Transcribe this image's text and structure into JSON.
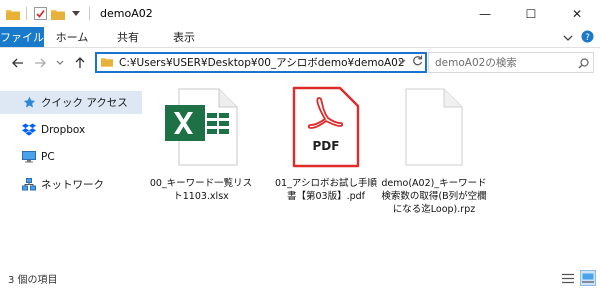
{
  "window": {
    "title": "demoA02",
    "minimize": "—",
    "maximize": "☐",
    "close": "✕"
  },
  "ribbon": {
    "tabs": [
      "ファイル",
      "ホーム",
      "共有",
      "表示"
    ]
  },
  "address": {
    "path": "C:¥Users¥USER¥Desktop¥00_アシロボdemo¥demoA02"
  },
  "search": {
    "placeholder": "demoA02の検索"
  },
  "sidebar": {
    "items": [
      {
        "label": "クイック アクセス",
        "icon": "star-icon"
      },
      {
        "label": "Dropbox",
        "icon": "dropbox-icon"
      },
      {
        "label": "PC",
        "icon": "pc-icon"
      },
      {
        "label": "ネットワーク",
        "icon": "network-icon"
      }
    ]
  },
  "files": [
    {
      "name": "00_キーワード一覧リスト1103.xlsx",
      "icon": "excel-file-icon"
    },
    {
      "name": "01_アシロボお試し手順書【第03版】.pdf",
      "icon": "pdf-file-icon"
    },
    {
      "name": "demo(A02)_キーワード検索数の取得(B列が空欄になる迄Loop).rpz",
      "icon": "generic-file-icon"
    }
  ],
  "pdf_label": "PDF",
  "status": {
    "count": "3 個の項目"
  },
  "colors": {
    "file_tab": "#1979ca",
    "address_border": "#1a73d0",
    "selection": "#dde8f4",
    "excel_green": "#1e7145",
    "pdf_red": "#e02b2b"
  }
}
